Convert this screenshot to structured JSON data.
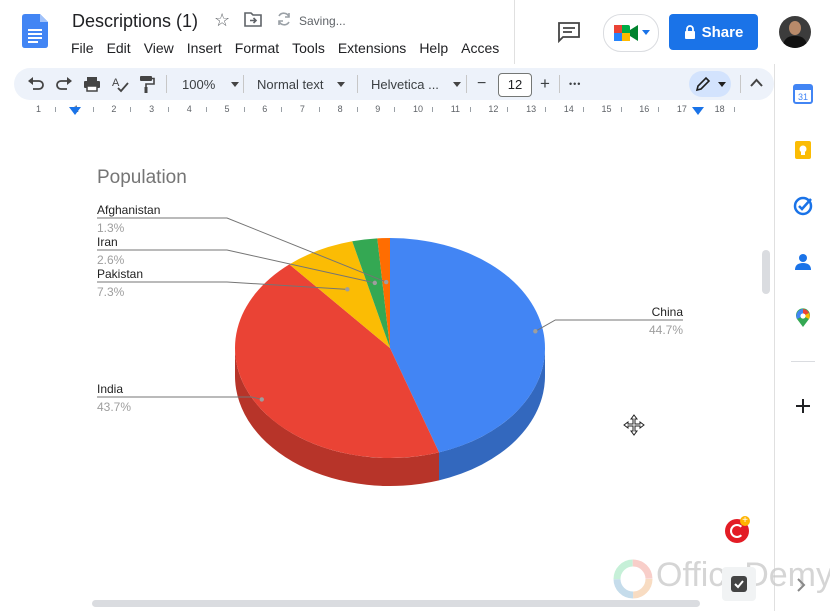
{
  "header": {
    "doc_title": "Descriptions (1)",
    "saving_text": "Saving...",
    "menu": [
      "File",
      "Edit",
      "View",
      "Insert",
      "Format",
      "Tools",
      "Extensions",
      "Help",
      "Acces"
    ],
    "share_label": "Share"
  },
  "toolbar": {
    "zoom": "100%",
    "style": "Normal text",
    "font": "Helvetica ...",
    "font_size": "12",
    "minus": "−",
    "plus": "+",
    "more": "•••"
  },
  "ruler": {
    "numbers": [
      "1",
      "1",
      "2",
      "3",
      "4",
      "5",
      "6",
      "7",
      "8",
      "9",
      "10",
      "11",
      "12",
      "13",
      "14",
      "15",
      "16",
      "17",
      "18"
    ]
  },
  "chart_data": {
    "type": "pie",
    "title": "Population",
    "three_d": true,
    "slices": [
      {
        "label": "China",
        "value": 44.7,
        "percent_label": "44.7%",
        "color": "#4285f4"
      },
      {
        "label": "India",
        "value": 43.7,
        "percent_label": "43.7%",
        "color": "#ea4335"
      },
      {
        "label": "Pakistan",
        "value": 7.3,
        "percent_label": "7.3%",
        "color": "#fbbc04"
      },
      {
        "label": "Iran",
        "value": 2.6,
        "percent_label": "2.6%",
        "color": "#34a853"
      },
      {
        "label": "Afghanistan",
        "value": 1.3,
        "percent_label": "1.3%",
        "color": "#ff6d01"
      }
    ]
  },
  "watermark": "OfficeDemy",
  "colors": {
    "accent": "#1a73e8",
    "toolbar_bg": "#edf2fa"
  }
}
